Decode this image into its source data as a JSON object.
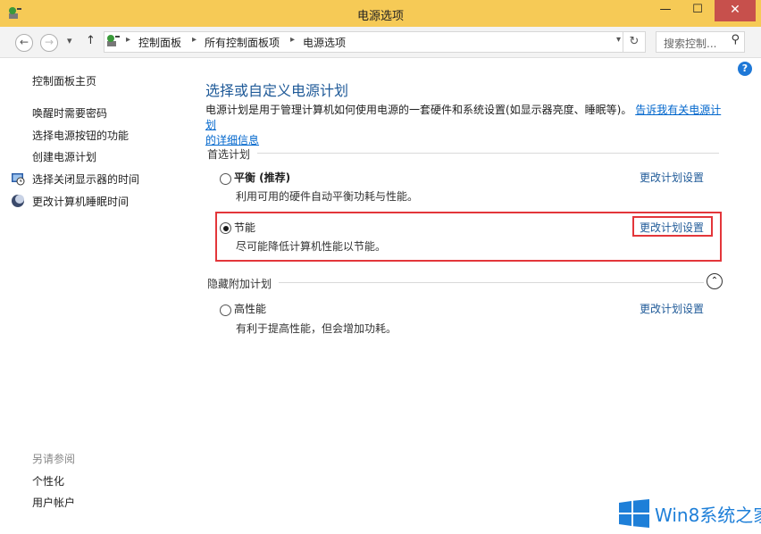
{
  "window": {
    "title": "电源选项",
    "minimize": "—",
    "maximize": "☐",
    "close": "✕"
  },
  "nav": {
    "back": "←",
    "forward": "→",
    "history": "▾",
    "up": "↑",
    "breadcrumbs": [
      "控制面板",
      "所有控制面板项",
      "电源选项"
    ],
    "search_placeholder": "搜索控制...",
    "help": "?"
  },
  "sidebar": {
    "home": "控制面板主页",
    "items": [
      {
        "label": "唤醒时需要密码",
        "icon": ""
      },
      {
        "label": "选择电源按钮的功能",
        "icon": ""
      },
      {
        "label": "创建电源计划",
        "icon": ""
      },
      {
        "label": "选择关闭显示器的时间",
        "icon": "monitor-clock-icon"
      },
      {
        "label": "更改计算机睡眠时间",
        "icon": "moon-icon"
      }
    ],
    "see_also": "另请参阅",
    "see_also_items": [
      "个性化",
      "用户帐户"
    ]
  },
  "main": {
    "heading": "选择或自定义电源计划",
    "description": "电源计划是用于管理计算机如何使用电源的一套硬件和系统设置(如显示器亮度、睡眠等)。",
    "description_link_1": "告诉我有关电源计划",
    "description_link_2": "的详细信息",
    "preferred_header": "首选计划",
    "hidden_header": "隐藏附加计划",
    "plans": [
      {
        "name": "平衡 (推荐)",
        "desc": "利用可用的硬件自动平衡功耗与性能。",
        "selected": false,
        "change": "更改计划设置"
      },
      {
        "name": "节能",
        "desc": "尽可能降低计算机性能以节能。",
        "selected": true,
        "change": "更改计划设置"
      },
      {
        "name": "高性能",
        "desc": "有利于提高性能，但会增加功耗。",
        "selected": false,
        "change": "更改计划设置"
      }
    ]
  },
  "watermark": {
    "text": "Win8系统之家"
  },
  "colors": {
    "titlebar": "#f6ca56",
    "heading": "#1f5a98",
    "highlight": "#e3363a",
    "link": "#0066cc",
    "watermark": "#1e7fd8"
  }
}
